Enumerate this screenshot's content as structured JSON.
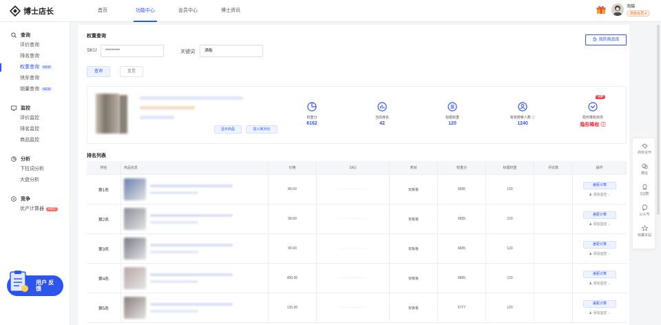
{
  "app": {
    "logo_text": "博士店长"
  },
  "nav": [
    "首页",
    "功能中心",
    "会员中心",
    "博士资讯"
  ],
  "nav_active": 1,
  "user": {
    "name": "淘猫",
    "badge": "高级会员 ▾"
  },
  "sidebar": {
    "sections": [
      {
        "title": "查询",
        "icon": "search-icon",
        "items": [
          {
            "label": "评价查询"
          },
          {
            "label": "排名查询"
          },
          {
            "label": "权重查询",
            "tag": "NEW",
            "active": true
          },
          {
            "label": "快车查询"
          },
          {
            "label": "销量查询",
            "tag": "NEW"
          }
        ]
      },
      {
        "title": "监控",
        "icon": "monitor-icon",
        "items": [
          {
            "label": "评价监控"
          },
          {
            "label": "排名监控"
          },
          {
            "label": "商品监控"
          }
        ]
      },
      {
        "title": "分析",
        "icon": "analysis-icon",
        "items": [
          {
            "label": "下拉词分析"
          },
          {
            "label": "大盘分析"
          }
        ]
      },
      {
        "title": "竞争",
        "icon": "compete-icon",
        "items": [
          {
            "label": "优产计算器",
            "tag": "HOT"
          }
        ]
      }
    ],
    "feedback": "用户 反馈"
  },
  "main": {
    "title": "权重查询",
    "my_products_btn": "我的商品库",
    "sku_label": "SKU",
    "sku_value": "*********",
    "keyword_label": "关键词",
    "keyword_value": "酒板",
    "query_btn": "查询",
    "reset_btn": "重置",
    "product_card": {
      "show_btn": "显示商品",
      "cart_btn": "加入到对比",
      "metrics": [
        {
          "label": "权重分",
          "value": "6162",
          "icon": "pie-chart-icon"
        },
        {
          "label": "当前排名",
          "value": "42",
          "icon": "bar-chart-icon"
        },
        {
          "label": "标题权重",
          "value": "120",
          "icon": "list-icon"
        },
        {
          "label": "有效搜索人数 ⓘ",
          "value": "1240",
          "icon": "user-icon"
        },
        {
          "label": "隐形降权状态",
          "value": "隐形降权 ⓘ",
          "icon": "status-icon",
          "vip": "VIP",
          "red": true
        }
      ]
    },
    "table_title": "排名列表",
    "columns": [
      "排名",
      "商品信息",
      "价格",
      "SKU",
      "类目",
      "权重分",
      "标题权重",
      "评论数",
      "操作"
    ],
    "rows": [
      {
        "rank": "第1名",
        "price": "89.00",
        "sku": "·······················",
        "category": "双板板",
        "weight": "6835",
        "title_weight": "120",
        "reviews": "",
        "calc": "差距计算",
        "add": "添加监控"
      },
      {
        "rank": "第2名",
        "price": "99.00",
        "sku": "·······················",
        "category": "双板板",
        "weight": "6835",
        "title_weight": "120",
        "reviews": "",
        "calc": "差距计算",
        "add": "添加监控"
      },
      {
        "rank": "第3名",
        "price": "99.00",
        "sku": "·······················",
        "category": "双板板",
        "weight": "6835",
        "title_weight": "120",
        "reviews": "",
        "calc": "差距计算",
        "add": "添加监控"
      },
      {
        "rank": "第4名",
        "price": "400.00",
        "sku": "·······················",
        "category": "双板板",
        "weight": "6806",
        "title_weight": "120",
        "reviews": "",
        "calc": "差距计算",
        "add": "添加监控"
      },
      {
        "rank": "第5名",
        "price": "135.00",
        "sku": "·······················",
        "category": "双板板",
        "weight": "6777",
        "title_weight": "120",
        "reviews": "",
        "calc": "差距计算",
        "add": "添加监控"
      }
    ]
  },
  "right_float": [
    {
      "label": "商务合作",
      "icon": "handshake-icon"
    },
    {
      "label": "微信",
      "icon": "wechat-icon"
    },
    {
      "label": "QQ群",
      "icon": "qq-icon"
    },
    {
      "label": "公众号",
      "icon": "chat-icon"
    },
    {
      "label": "收藏本站",
      "icon": "star-icon"
    }
  ]
}
